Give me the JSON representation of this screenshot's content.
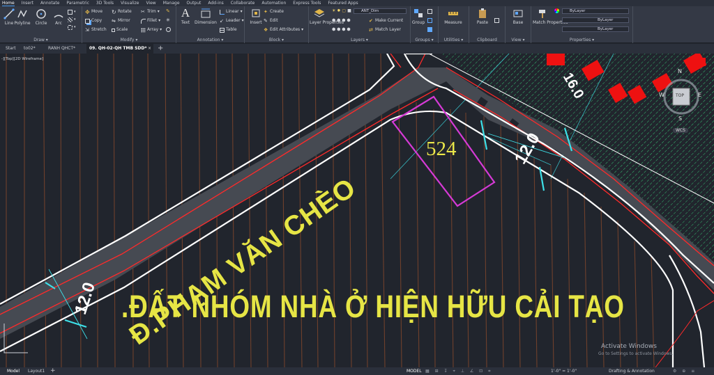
{
  "ribbon_tabs": [
    "Home",
    "Insert",
    "Annotate",
    "Parametric",
    "3D Tools",
    "Visualize",
    "View",
    "Manage",
    "Output",
    "Add-ins",
    "Collaborate",
    "Automation",
    "Express Tools",
    "Featured Apps"
  ],
  "draw": {
    "line": "Line",
    "polyline": "Polyline",
    "circle": "Circle",
    "arc": "Arc",
    "title": "Draw ▾"
  },
  "modify": {
    "move": "Move",
    "rotate": "Rotate",
    "trim": "Trim",
    "copy": "Copy",
    "mirror": "Mirror",
    "fillet": "Fillet",
    "stretch": "Stretch",
    "scale": "Scale",
    "array": "Array",
    "title": "Modify ▾"
  },
  "annotation": {
    "text": "Text",
    "dimension": "Dimension",
    "linear": "Linear",
    "leader": "Leader",
    "table": "Table",
    "title": "Annotation ▾"
  },
  "block": {
    "insert": "Insert",
    "create": "Create",
    "edit": "Edit",
    "edit_attributes": "Edit Attributes",
    "title": "Block ▾"
  },
  "layers": {
    "layer_properties": "Layer Properties",
    "current_layer": "ANT_Dim",
    "make_current": "Make Current",
    "match_layer": "Match Layer",
    "title": "Layers ▾"
  },
  "groups": {
    "group": "Group",
    "title": "Groups ▾"
  },
  "utilities": {
    "measure": "Measure",
    "title": "Utilities ▾"
  },
  "clipboard": {
    "paste": "Paste",
    "title": "Clipboard"
  },
  "view_panel": {
    "base": "Base",
    "title": "View ▾"
  },
  "properties": {
    "match_properties": "Match Properties",
    "color": "ByLayer",
    "lineweight": "ByLayer",
    "linetype": "ByLayer",
    "title": "Properties ▾"
  },
  "doc_tabs": [
    "Start",
    "to02*",
    "RANH QHCT*",
    "09. QH-02-QH TMB SDD*"
  ],
  "viewport_label": "-][Top][2D Wireframe]",
  "drawing": {
    "street_label": "Đ.PHẠM VĂN CHÈO",
    "zone_label": ".ĐẤT NHÓM NHÀ Ở HIỆN HỮU CẢI TẠO",
    "lot_number": "524",
    "width_dim_1": "12.0",
    "width_dim_2": "12.0",
    "red_text": "16.0"
  },
  "viewcube": {
    "n": "N",
    "s": "S",
    "w": "W",
    "e": "E",
    "top": "TOP",
    "wcs": "WCS"
  },
  "watermark": {
    "title": "Activate Windows",
    "sub": "Go to Settings to activate Windows."
  },
  "status": {
    "model_tab": "Model",
    "layout_tab": "Layout1",
    "mode": "MODEL",
    "scale": "1'-0\" = 1'-0\"",
    "workspace": "Drafting & Annotation"
  },
  "colors": {
    "road_fill": "#464a52",
    "road_edge": "#ff2a2a",
    "boundary": "#ffffff",
    "street_text": "#e6e545",
    "lot_outline": "#d63ad6",
    "hatch": "#39d07a",
    "cyan": "#3de0e8",
    "red_block": "#ee1111"
  }
}
